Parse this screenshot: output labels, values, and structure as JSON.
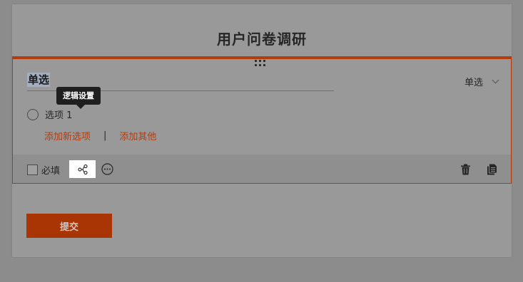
{
  "form": {
    "title": "用户问卷调研"
  },
  "question": {
    "title": "单选",
    "type_label": "单选",
    "options": [
      {
        "label": "选项 1"
      }
    ],
    "add_option_label": "添加新选项",
    "separator": "|",
    "add_other_label": "添加其他"
  },
  "toolbar": {
    "required_label": "必填",
    "logic_tooltip": "逻辑设置"
  },
  "actions": {
    "submit_label": "提交"
  },
  "icons": {
    "drag": "drag-handle-icon",
    "dropdown": "chevron-down-icon",
    "logic": "logic-flow-icon",
    "more": "more-icon",
    "delete": "trash-icon",
    "copy": "copy-icon"
  },
  "colors": {
    "accent": "#b43b0c",
    "submit": "#a93505",
    "background": "#999999"
  }
}
